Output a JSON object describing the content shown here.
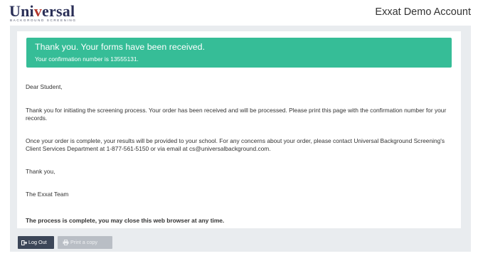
{
  "header": {
    "logo": {
      "word_start": "Uni",
      "word_accent": "v",
      "word_end": "ersal",
      "tagline": "BACKGROUND SCREENING"
    },
    "account_name": "Exxat Demo Account"
  },
  "alert": {
    "title": "Thank you. Your forms have been received.",
    "confirmation": "Your confirmation number is 13555131."
  },
  "letter": {
    "greeting": "Dear Student,",
    "para1": "Thank you for initiating the screening process. Your order has been received and will be processed. Please print this page with the confirmation number for your records.",
    "para2": "Once your order is complete, your results will be provided to your school. For any concerns about your order, please contact Universal Background Screening's Client Services Department at 1-877-561-5150 or via email at cs@universalbackground.com.",
    "closing": "Thank you,",
    "signature": "The Exxat Team",
    "final_note": "The process is complete, you may close this web browser at any time."
  },
  "buttons": {
    "logout_label": "Log Out",
    "logout_icon": "logout-icon",
    "print_label": "Print a copy",
    "print_icon": "printer-icon"
  },
  "colors": {
    "alert_bg": "#36bd97",
    "logout_bg": "#3c4658",
    "print_bg": "#b9bec5",
    "brand_navy": "#2a2f57",
    "brand_red": "#b2372d"
  }
}
